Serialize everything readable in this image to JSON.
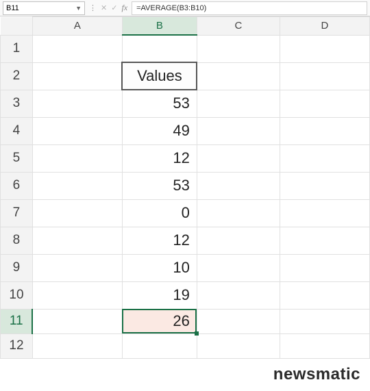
{
  "formula_bar": {
    "name_box": "B11",
    "formula": "=AVERAGE(B3:B10)"
  },
  "columns": [
    "A",
    "B",
    "C",
    "D"
  ],
  "active_column": "B",
  "active_row": "11",
  "rows": [
    "1",
    "2",
    "3",
    "4",
    "5",
    "6",
    "7",
    "8",
    "9",
    "10",
    "11",
    "12"
  ],
  "cells": {
    "B2": "Values",
    "B3": "53",
    "B4": "49",
    "B5": "12",
    "B6": "53",
    "B7": "0",
    "B8": "12",
    "B9": "10",
    "B10": "19",
    "B11": "26"
  },
  "watermark": "newsmatic"
}
